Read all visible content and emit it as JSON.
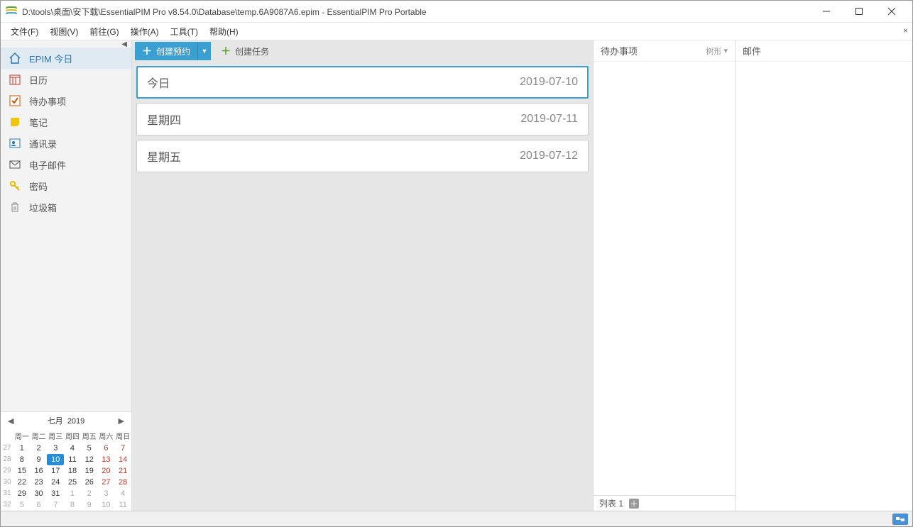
{
  "titlebar": {
    "title": "D:\\tools\\桌面\\安下载\\EssentialPIM Pro v8.54.0\\Database\\temp.6A9087A6.epim - EssentialPIM Pro Portable"
  },
  "menubar": {
    "items": [
      "文件(F)",
      "视图(V)",
      "前往(G)",
      "操作(A)",
      "工具(T)",
      "帮助(H)"
    ]
  },
  "sidebar": {
    "items": [
      {
        "label": "EPIM 今日",
        "active": true
      },
      {
        "label": "日历"
      },
      {
        "label": "待办事项"
      },
      {
        "label": "笔记"
      },
      {
        "label": "通讯录"
      },
      {
        "label": "电子邮件"
      },
      {
        "label": "密码"
      },
      {
        "label": "垃圾箱"
      }
    ]
  },
  "mini_cal": {
    "month_label": "七月",
    "year_label": "2019",
    "weekday_headers": [
      "周一",
      "周二",
      "周三",
      "周四",
      "周五",
      "周六",
      "周日"
    ],
    "rows": [
      {
        "wk": "27",
        "days": [
          {
            "n": "1"
          },
          {
            "n": "2"
          },
          {
            "n": "3"
          },
          {
            "n": "4"
          },
          {
            "n": "5"
          },
          {
            "n": "6",
            "red": true
          },
          {
            "n": "7",
            "red": true
          }
        ]
      },
      {
        "wk": "28",
        "days": [
          {
            "n": "8"
          },
          {
            "n": "9"
          },
          {
            "n": "10",
            "today": true
          },
          {
            "n": "11"
          },
          {
            "n": "12"
          },
          {
            "n": "13",
            "red": true
          },
          {
            "n": "14",
            "red": true
          }
        ]
      },
      {
        "wk": "29",
        "days": [
          {
            "n": "15"
          },
          {
            "n": "16"
          },
          {
            "n": "17"
          },
          {
            "n": "18"
          },
          {
            "n": "19"
          },
          {
            "n": "20",
            "red": true
          },
          {
            "n": "21",
            "red": true
          }
        ]
      },
      {
        "wk": "30",
        "days": [
          {
            "n": "22"
          },
          {
            "n": "23"
          },
          {
            "n": "24"
          },
          {
            "n": "25"
          },
          {
            "n": "26"
          },
          {
            "n": "27",
            "red": true
          },
          {
            "n": "28",
            "red": true
          }
        ]
      },
      {
        "wk": "31",
        "days": [
          {
            "n": "29"
          },
          {
            "n": "30"
          },
          {
            "n": "31"
          },
          {
            "n": "1",
            "other": true
          },
          {
            "n": "2",
            "other": true
          },
          {
            "n": "3",
            "other": true,
            "red": true
          },
          {
            "n": "4",
            "other": true,
            "red": true
          }
        ]
      },
      {
        "wk": "32",
        "days": [
          {
            "n": "5",
            "other": true
          },
          {
            "n": "6",
            "other": true
          },
          {
            "n": "7",
            "other": true
          },
          {
            "n": "8",
            "other": true
          },
          {
            "n": "9",
            "other": true
          },
          {
            "n": "10",
            "other": true,
            "red": true
          },
          {
            "n": "11",
            "other": true,
            "red": true
          }
        ]
      }
    ]
  },
  "toolbar": {
    "create_appointment": "创建预约",
    "create_task": "创建任务"
  },
  "days": [
    {
      "title": "今日",
      "date": "2019-07-10",
      "active": true
    },
    {
      "title": "星期四",
      "date": "2019-07-11"
    },
    {
      "title": "星期五",
      "date": "2019-07-12"
    }
  ],
  "todo_panel": {
    "title": "待办事项",
    "mode": "树形",
    "footer_label": "列表 1"
  },
  "mail_panel": {
    "title": "邮件"
  }
}
